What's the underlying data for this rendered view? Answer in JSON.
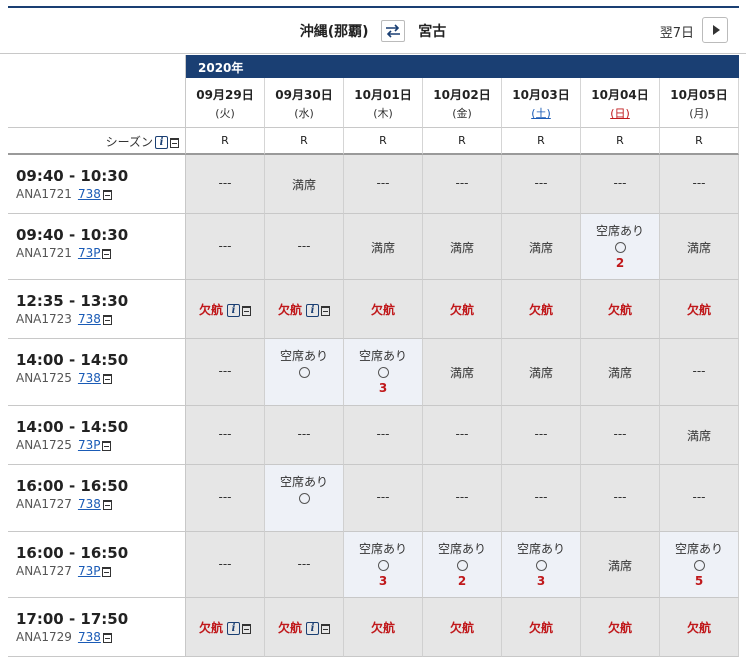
{
  "route": {
    "origin": "沖縄(那覇)",
    "destination": "宮古",
    "next_label": "翌7日"
  },
  "year_label": "2020年",
  "season_label": "シーズン",
  "dates": [
    {
      "date": "09月29日",
      "weekday": "(火)",
      "kind": "weekday"
    },
    {
      "date": "09月30日",
      "weekday": "(水)",
      "kind": "weekday"
    },
    {
      "date": "10月01日",
      "weekday": "(木)",
      "kind": "weekday"
    },
    {
      "date": "10月02日",
      "weekday": "(金)",
      "kind": "weekday"
    },
    {
      "date": "10月03日",
      "weekday": "(土)",
      "kind": "sat"
    },
    {
      "date": "10月04日",
      "weekday": "(日)",
      "kind": "sun"
    },
    {
      "date": "10月05日",
      "weekday": "(月)",
      "kind": "weekday"
    }
  ],
  "seasons": [
    "R",
    "R",
    "R",
    "R",
    "R",
    "R",
    "R"
  ],
  "labels": {
    "dash": "---",
    "full": "満席",
    "cancel": "欠航",
    "avail": "空席あり"
  },
  "flights": [
    {
      "time": "09:40 - 10:30",
      "flight": "ANA1721",
      "aircraft": "738",
      "cells": [
        {
          "s": "dash"
        },
        {
          "s": "full"
        },
        {
          "s": "dash"
        },
        {
          "s": "dash"
        },
        {
          "s": "dash"
        },
        {
          "s": "dash"
        },
        {
          "s": "dash"
        }
      ]
    },
    {
      "time": "09:40 - 10:30",
      "flight": "ANA1721",
      "aircraft": "73P",
      "cells": [
        {
          "s": "dash"
        },
        {
          "s": "dash"
        },
        {
          "s": "full"
        },
        {
          "s": "full"
        },
        {
          "s": "full"
        },
        {
          "s": "avail",
          "n": "2"
        },
        {
          "s": "full"
        }
      ]
    },
    {
      "time": "12:35 - 13:30",
      "flight": "ANA1723",
      "aircraft": "738",
      "cells": [
        {
          "s": "cancel",
          "info": true
        },
        {
          "s": "cancel",
          "info": true
        },
        {
          "s": "cancel"
        },
        {
          "s": "cancel"
        },
        {
          "s": "cancel"
        },
        {
          "s": "cancel"
        },
        {
          "s": "cancel"
        }
      ]
    },
    {
      "time": "14:00 - 14:50",
      "flight": "ANA1725",
      "aircraft": "738",
      "cells": [
        {
          "s": "dash"
        },
        {
          "s": "avail"
        },
        {
          "s": "avail",
          "n": "3"
        },
        {
          "s": "full"
        },
        {
          "s": "full"
        },
        {
          "s": "full"
        },
        {
          "s": "dash"
        }
      ]
    },
    {
      "time": "14:00 - 14:50",
      "flight": "ANA1725",
      "aircraft": "73P",
      "cells": [
        {
          "s": "dash"
        },
        {
          "s": "dash"
        },
        {
          "s": "dash"
        },
        {
          "s": "dash"
        },
        {
          "s": "dash"
        },
        {
          "s": "dash"
        },
        {
          "s": "full"
        }
      ]
    },
    {
      "time": "16:00 - 16:50",
      "flight": "ANA1727",
      "aircraft": "738",
      "cells": [
        {
          "s": "dash"
        },
        {
          "s": "avail"
        },
        {
          "s": "dash"
        },
        {
          "s": "dash"
        },
        {
          "s": "dash"
        },
        {
          "s": "dash"
        },
        {
          "s": "dash"
        }
      ]
    },
    {
      "time": "16:00 - 16:50",
      "flight": "ANA1727",
      "aircraft": "73P",
      "cells": [
        {
          "s": "dash"
        },
        {
          "s": "dash"
        },
        {
          "s": "avail",
          "n": "3"
        },
        {
          "s": "avail",
          "n": "2"
        },
        {
          "s": "avail",
          "n": "3"
        },
        {
          "s": "full"
        },
        {
          "s": "avail",
          "n": "5"
        }
      ]
    },
    {
      "time": "17:00 - 17:50",
      "flight": "ANA1729",
      "aircraft": "738",
      "cells": [
        {
          "s": "cancel",
          "info": true
        },
        {
          "s": "cancel",
          "info": true
        },
        {
          "s": "cancel"
        },
        {
          "s": "cancel"
        },
        {
          "s": "cancel"
        },
        {
          "s": "cancel"
        },
        {
          "s": "cancel"
        }
      ]
    }
  ]
}
